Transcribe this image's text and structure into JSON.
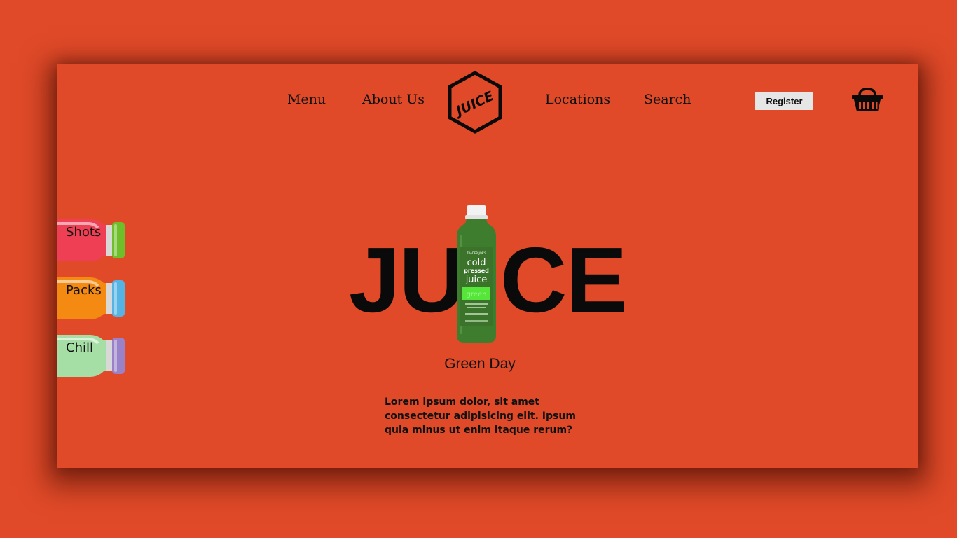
{
  "nav": {
    "menu": "Menu",
    "about": "About Us",
    "locations": "Locations",
    "search": "Search"
  },
  "logo": {
    "text": "JUICE"
  },
  "header": {
    "register_label": "Register",
    "cart_icon": "basket-icon"
  },
  "sidebar": {
    "items": [
      {
        "label": "Shots",
        "liquid_color": "#ee3f55",
        "cap_color": "#6fbf2a"
      },
      {
        "label": "Packs",
        "liquid_color": "#f58a12",
        "cap_color": "#55b4e4"
      },
      {
        "label": "Chill",
        "liquid_color": "#a6dfa6",
        "cap_color": "#9a82c8"
      }
    ]
  },
  "hero": {
    "word_left": "JU",
    "word_right": "CE",
    "product_name": "Green Day",
    "description": "Lorem ipsum dolor, sit amet consectetur adipisicing elit. Ipsum quia minus ut enim itaque rerum?"
  },
  "bottle": {
    "brand": "TRADER JOE'S",
    "line1": "cold",
    "line2": "pressed",
    "line3": "juice",
    "variant": "green",
    "liquid_color": "#3f7d2e",
    "label_accent": "#56e63a"
  },
  "theme": {
    "background": "#e04a28",
    "text": "#111111"
  }
}
